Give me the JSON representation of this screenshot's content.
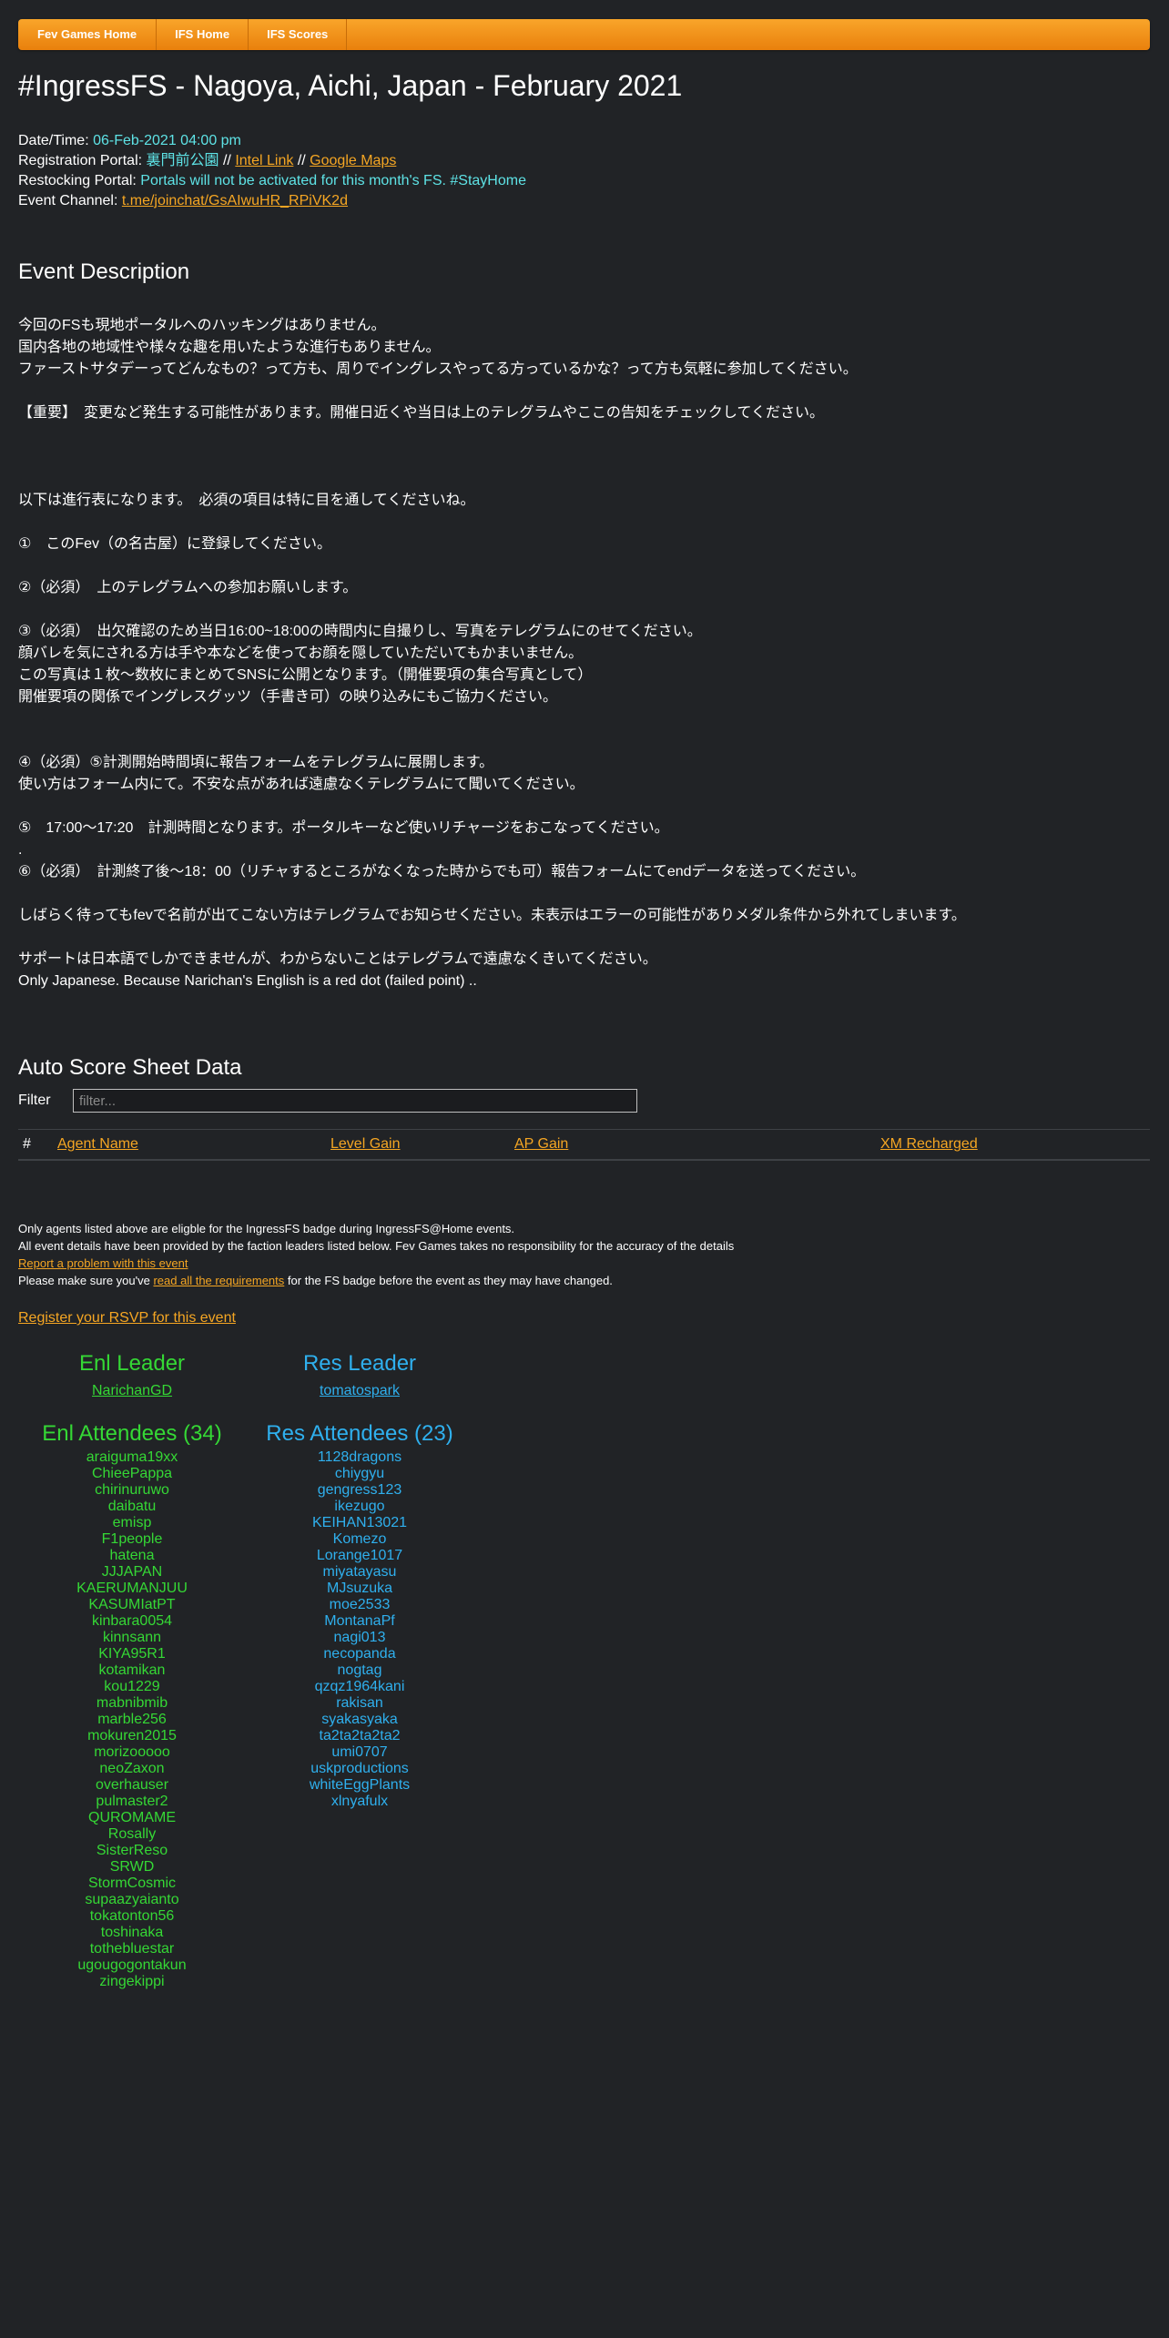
{
  "nav": {
    "items": [
      {
        "label": "Fev Games Home"
      },
      {
        "label": "IFS Home"
      },
      {
        "label": "IFS Scores"
      }
    ]
  },
  "page_title": "#IngressFS - Nagoya, Aichi, Japan - February 2021",
  "info": {
    "datetime_label": "Date/Time:",
    "datetime_value": "06-Feb-2021 04:00 pm",
    "registration_label": "Registration Portal:",
    "registration_value": "裏門前公園",
    "sep1": "//",
    "intel_link": "Intel Link",
    "sep2": "//",
    "maps_link": "Google Maps",
    "restocking_label": "Restocking Portal:",
    "restocking_value": "Portals will not be activated for this month's FS. #StayHome",
    "channel_label": "Event Channel:",
    "channel_link": "t.me/joinchat/GsAIwuHR_RPiVK2d"
  },
  "description": {
    "heading": "Event Description",
    "text": "今回のFSも現地ポータルへのハッキングはありません。\n国内各地の地域性や様々な趣を用いたような進行もありません。\nファーストサタデーってどんなもの？って方も、周りでイングレスやってる方っているかな？って方も気軽に参加してください。\n\n【重要】　変更など発生する可能性があります。開催日近くや当日は上のテレグラムやここの告知をチェックしてください。\n\n\n\n以下は進行表になります。　必須の項目は特に目を通してくださいね。\n\n①　このFev（の名古屋）に登録してください。\n\n②（必須）　上のテレグラムへの参加お願いします。\n\n③（必須）　出欠確認のため当日16:00~18:00の時間内に自撮りし、写真をテレグラムにのせてください。\n顔バレを気にされる方は手や本などを使ってお顔を隠していただいてもかまいません。\nこの写真は１枚～数枚にまとめてSNSに公開となります。（開催要項の集合写真として）\n開催要項の関係でイングレスグッツ（手書き可）の映り込みにもご協力ください。\n\n\n④（必須）⑤計測開始時間頃に報告フォームをテレグラムに展開します。\n使い方はフォーム内にて。不安な点があれば遠慮なくテレグラムにて聞いてください。\n\n⑤　17:00～17:20　計測時間となります。ポータルキーなど使いリチャージをおこなってください。\n.\n⑥（必須）　計測終了後～18：00（リチャするところがなくなった時からでも可）報告フォームにてendデータを送ってください。\n\nしばらく待ってもfevで名前が出てこない方はテレグラムでお知らせください。未表示はエラーの可能性がありメダル条件から外れてしまいます。\n\nサポートは日本語でしかできませんが、わからないことはテレグラムで遠慮なくきいてください。\nOnly Japanese. Because Narichan's English is a red dot (failed point) .."
  },
  "scores": {
    "heading": "Auto Score Sheet Data",
    "filter_label": "Filter",
    "filter_placeholder": "filter...",
    "columns": [
      "#",
      "Agent Name",
      "Level Gain",
      "AP Gain",
      "XM Recharged"
    ]
  },
  "notes": {
    "line1": "Only agents listed above are eligble for the IngressFS badge during IngressFS@Home events.",
    "line2": "All event details have been provided by the faction leaders listed below. Fev Games takes no responsibility for the accuracy of the details",
    "report_link": "Report a problem with this event",
    "line4_pre": "Please make sure you've",
    "requirements_link": "read all the requirements",
    "line4_post": "for the FS badge before the event as they may have changed."
  },
  "rsvp_link": "Register your RSVP for this event",
  "enl": {
    "leader_heading": "Enl Leader",
    "leader": "NarichanGD",
    "attendees_heading": "Enl Attendees (34)",
    "attendees": [
      "araiguma19xx",
      "ChieePappa",
      "chirinuruwo",
      "daibatu",
      "emisp",
      "F1people",
      "hatena",
      "JJJAPAN",
      "KAERUMANJUU",
      "KASUMIatPT",
      "kinbara0054",
      "kinnsann",
      "KIYA95R1",
      "kotamikan",
      "kou1229",
      "mabnibmib",
      "marble256",
      "mokuren2015",
      "morizooooo",
      "neoZaxon",
      "overhauser",
      "pulmaster2",
      "QUROMAME",
      "Rosally",
      "SisterReso",
      "SRWD",
      "StormCosmic",
      "supaazyaianto",
      "tokatonton56",
      "toshinaka",
      "tothebluestar",
      "ugougogontakun",
      "zingekippi"
    ]
  },
  "res": {
    "leader_heading": "Res Leader",
    "leader": "tomatospark",
    "attendees_heading": "Res Attendees (23)",
    "attendees": [
      "1128dragons",
      "chiygyu",
      "gengress123",
      "ikezugo",
      "KEIHAN13021",
      "Komezo",
      "Lorange1017",
      "miyatayasu",
      "MJsuzuka",
      "moe2533",
      "MontanaPf",
      "nagi013",
      "necopanda",
      "nogtag",
      "qzqz1964kani",
      "rakisan",
      "syakasyaka",
      "ta2ta2ta2ta2",
      "umi0707",
      "uskproductions",
      "whiteEggPlants",
      "xlnyafulx"
    ]
  },
  "colors": {
    "background": "#212326",
    "nav_orange": "#f5931f",
    "link": "#f5a623",
    "info_value": "#5ee3e6",
    "enl": "#35d835",
    "res": "#2fb0ee"
  }
}
